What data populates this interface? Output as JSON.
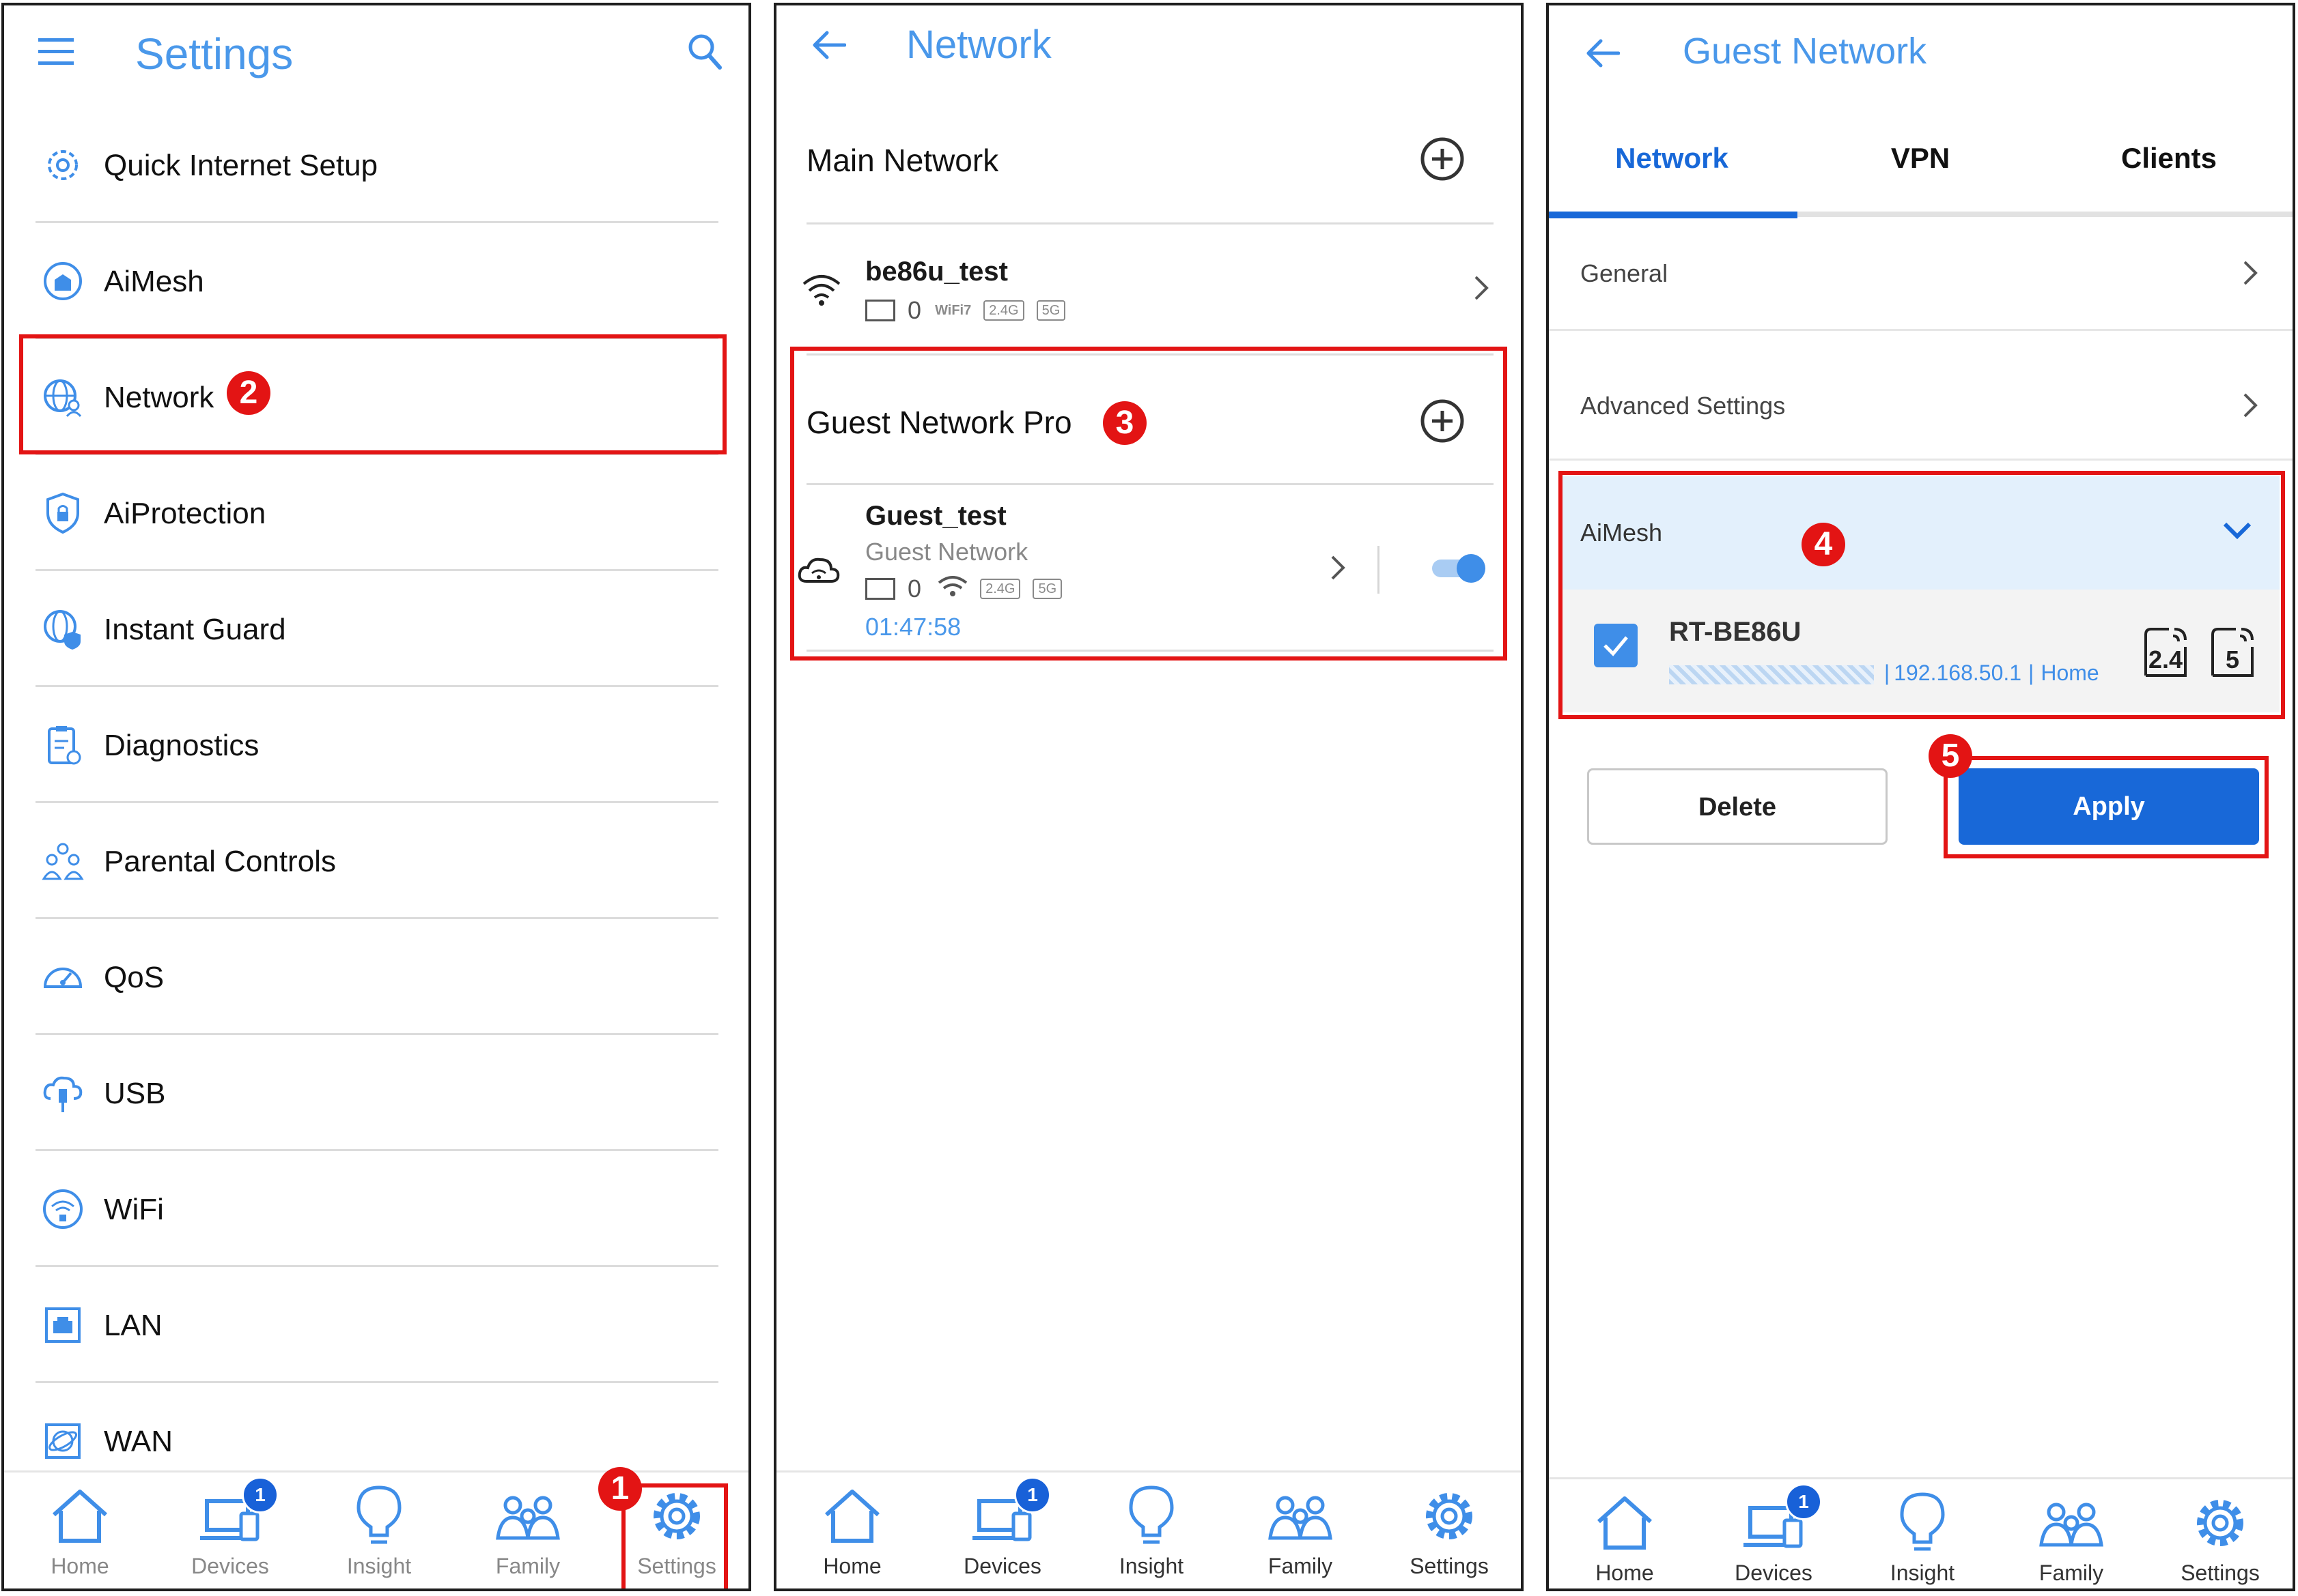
{
  "settings_screen": {
    "title": "Settings",
    "items": [
      {
        "label": "Quick Internet Setup",
        "icon": "gear-sparkle-icon"
      },
      {
        "label": "AiMesh",
        "icon": "aimesh-icon"
      },
      {
        "label": "Network",
        "icon": "globe-user-icon"
      },
      {
        "label": "AiProtection",
        "icon": "shield-lock-icon"
      },
      {
        "label": "Instant Guard",
        "icon": "globe-shield-icon"
      },
      {
        "label": "Diagnostics",
        "icon": "clipboard-icon"
      },
      {
        "label": "Parental Controls",
        "icon": "family-icon"
      },
      {
        "label": "QoS",
        "icon": "speedometer-icon"
      },
      {
        "label": "USB",
        "icon": "usb-cloud-icon"
      },
      {
        "label": "WiFi",
        "icon": "wifi-shield-icon"
      },
      {
        "label": "LAN",
        "icon": "lan-port-icon"
      },
      {
        "label": "WAN",
        "icon": "wan-globe-icon"
      }
    ]
  },
  "network_screen": {
    "title": "Network",
    "main_section": "Main Network",
    "main_ssid": "be86u_test",
    "main_clients": "0",
    "main_tags": [
      "WiFi7",
      "2.4G",
      "5G"
    ],
    "guest_section": "Guest Network Pro",
    "guest_ssid": "Guest_test",
    "guest_type": "Guest Network",
    "guest_clients": "0",
    "guest_tags": [
      "2.4G",
      "5G"
    ],
    "guest_timer": "01:47:58"
  },
  "guest_screen": {
    "title": "Guest Network",
    "tabs": [
      "Network",
      "VPN",
      "Clients"
    ],
    "general": "General",
    "advanced": "Advanced Settings",
    "aimesh": "AiMesh",
    "node_name": "RT-BE86U",
    "node_ip": "192.168.50.1",
    "node_location": "Home",
    "band_24": "2.4",
    "band_5": "5",
    "delete_label": "Delete",
    "apply_label": "Apply"
  },
  "nav": [
    "Home",
    "Devices",
    "Insight",
    "Family",
    "Settings"
  ],
  "devices_badge": "1",
  "steps": [
    "1",
    "2",
    "3",
    "4",
    "5"
  ],
  "colors": {
    "accent": "#3f8ee8",
    "annotation": "#e31414",
    "apply": "#1868d8"
  }
}
